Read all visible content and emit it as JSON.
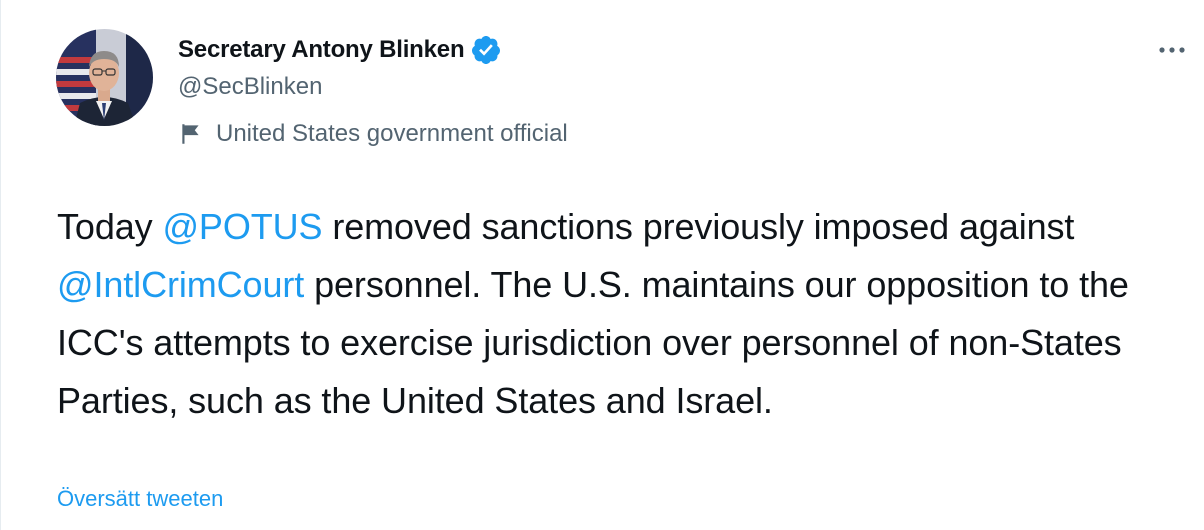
{
  "author": {
    "display_name": "Secretary Antony Blinken",
    "handle": "@SecBlinken",
    "label": "United States government official",
    "verified": true
  },
  "tweet": {
    "parts": {
      "p1": "Today ",
      "m1": "@POTUS",
      "p2": " removed sanctions previously imposed against ",
      "m2": "@IntlCrimCourt",
      "p3": " personnel. The U.S. maintains our opposition to the ICC's attempts to exercise jurisdiction over personnel of non-States Parties, such as the United States and Israel."
    }
  },
  "actions": {
    "translate_label": "Översätt tweeten"
  },
  "icons": {
    "verified": "verified-badge-icon",
    "flag": "flag-icon",
    "more": "more-dots-icon"
  },
  "colors": {
    "accent": "#1d9bf0",
    "secondary_text": "#536471",
    "primary_text": "#0f1419"
  }
}
